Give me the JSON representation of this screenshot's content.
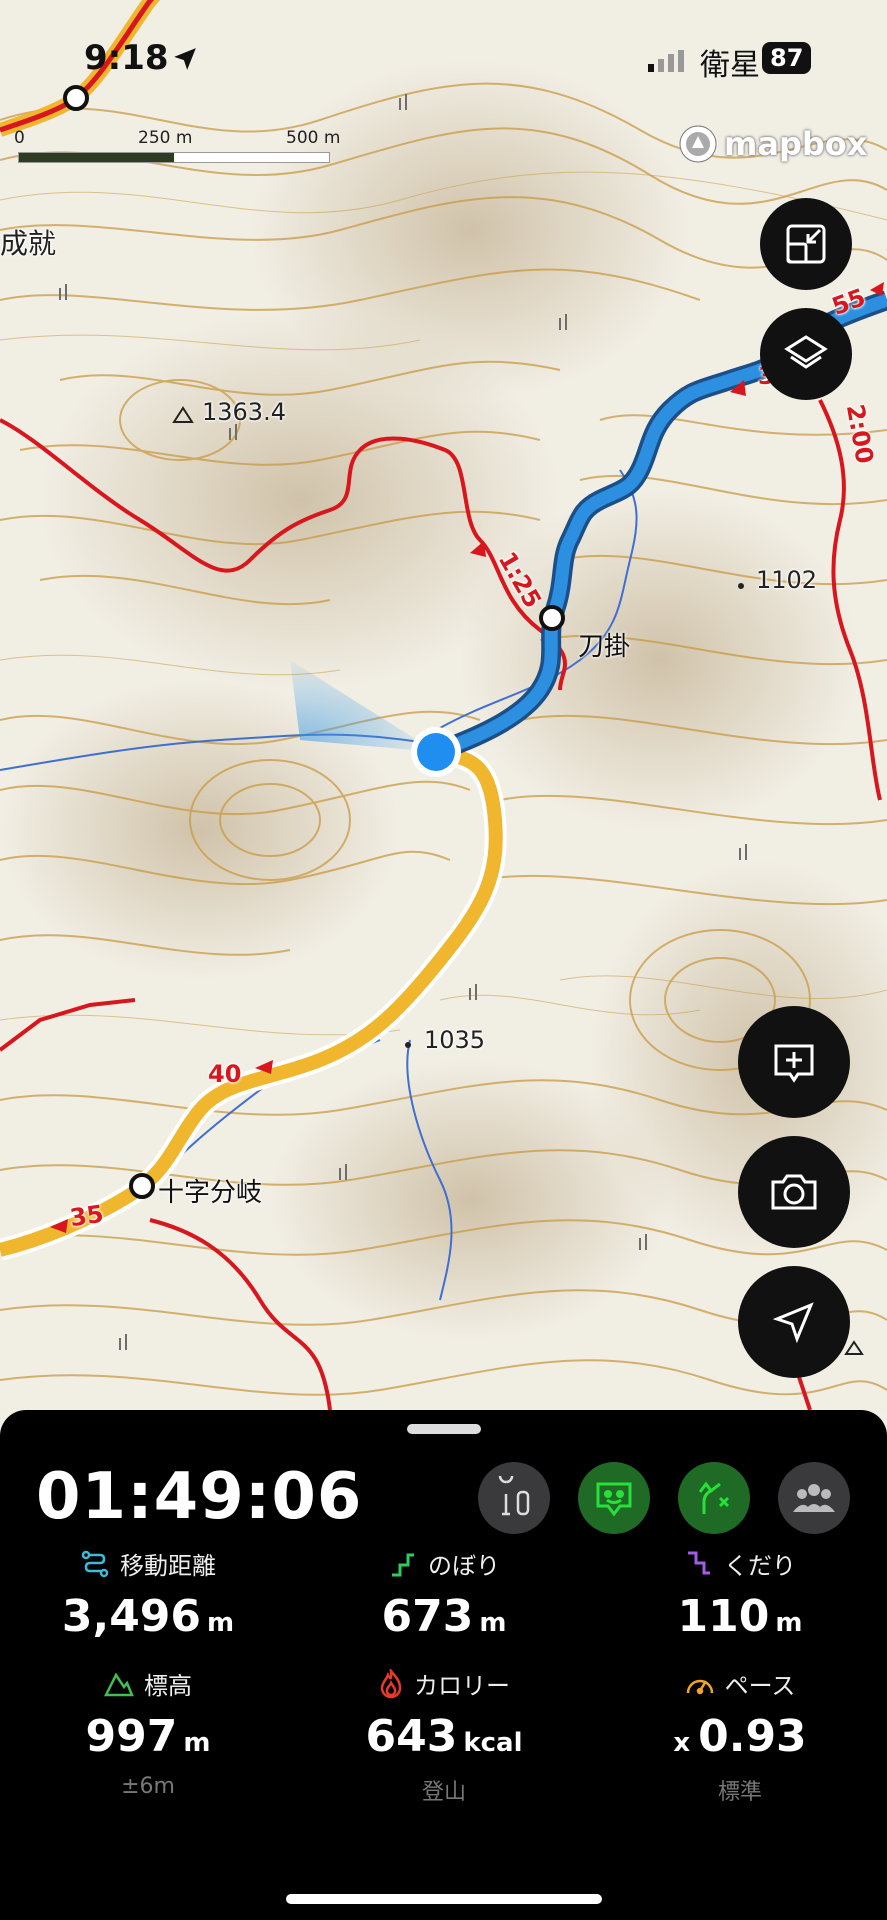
{
  "status_bar": {
    "time": "9:18",
    "carrier": "衛星",
    "battery": "87"
  },
  "map": {
    "attribution": "mapbox",
    "scale": {
      "labels": [
        "0",
        "250 m",
        "500 m"
      ]
    },
    "labels": {
      "peak_1363": "1363.4",
      "peak_1102": "1102",
      "peak_1035": "1035",
      "place_left": "成就",
      "waypoint_katanakake": "刀掛",
      "waypoint_jujibunki": "十字分岐"
    },
    "route_time_labels": [
      "1:25",
      "2:00",
      "40",
      "35",
      "55",
      "3"
    ]
  },
  "controls": {
    "icons": [
      "shrink-icon",
      "layers-icon",
      "note-add-icon",
      "camera-icon",
      "navigation-arrow-icon"
    ]
  },
  "activity": {
    "elapsed": "01:49:06",
    "stats": [
      {
        "label": "移動距離",
        "value": "3,496",
        "unit": "m",
        "sub": ""
      },
      {
        "label": "のぼり",
        "value": "673",
        "unit": "m",
        "sub": ""
      },
      {
        "label": "くだり",
        "value": "110",
        "unit": "m",
        "sub": ""
      },
      {
        "label": "標高",
        "value": "997",
        "unit": "m",
        "sub": "±6m"
      },
      {
        "label": "カロリー",
        "value": "643",
        "unit": "kcal",
        "sub": "登山"
      },
      {
        "label": "ペース",
        "prefix": "x",
        "value": "0.93",
        "unit": "",
        "sub": "標準"
      }
    ]
  },
  "colors": {
    "route_trail": "#f0b62d",
    "track_blue": "#2d8fe0",
    "red_route": "#d8161e",
    "contour": "#c99a44",
    "green_button": "#1f6b25",
    "panel_bg": "#000000"
  }
}
